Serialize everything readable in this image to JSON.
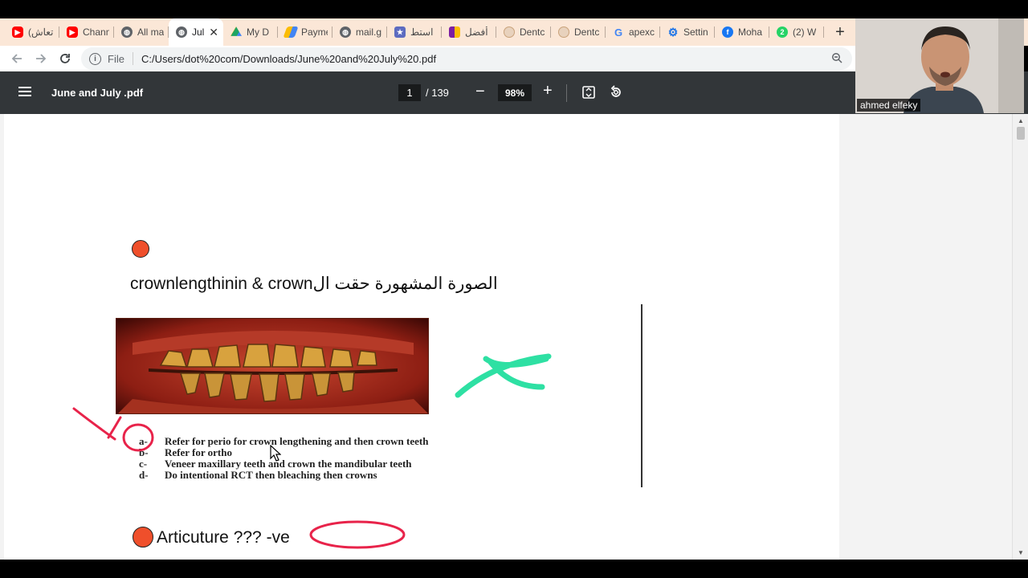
{
  "browser": {
    "tabs": [
      {
        "title": "(تعاش",
        "icon": "youtube-icon",
        "color": "#ff0000"
      },
      {
        "title": "Chann",
        "icon": "youtube-icon",
        "color": "#ff0000"
      },
      {
        "title": "All ma",
        "icon": "globe-icon",
        "color": "#5f6368"
      },
      {
        "title": "Jul",
        "icon": "globe-icon",
        "color": "#5f6368",
        "active": true
      },
      {
        "title": "My D",
        "icon": "google-drive-icon",
        "color": "#1fa463"
      },
      {
        "title": "Payme",
        "icon": "google-ads-icon",
        "color": "#fbbc04"
      },
      {
        "title": "mail.g",
        "icon": "globe-icon",
        "color": "#5f6368"
      },
      {
        "title": "استط",
        "icon": "bookmark-icon",
        "color": "#5c6bc0"
      },
      {
        "title": "أفضل",
        "icon": "slides-icon",
        "color": "#7b1fa2"
      },
      {
        "title": "Dentc",
        "icon": "dental-site-icon",
        "color": "#c9a27a"
      },
      {
        "title": "Dentc",
        "icon": "dental-site-icon",
        "color": "#c9a27a"
      },
      {
        "title": "apexc",
        "icon": "google-icon",
        "color": "#4285f4"
      },
      {
        "title": "Settin",
        "icon": "gear-icon",
        "color": "#1a73e8"
      },
      {
        "title": "Moha",
        "icon": "facebook-icon",
        "color": "#1877f2"
      },
      {
        "title": "(2) W",
        "icon": "whatsapp-icon",
        "color": "#25d366"
      }
    ],
    "new_tab_label": "+",
    "address": {
      "scheme_label": "File",
      "url": "C:/Users/dot%20com/Downloads/June%20and%20July%20.pdf"
    }
  },
  "pdf": {
    "title": "June and July .pdf",
    "current_page": "1",
    "total_pages": "/ 139",
    "zoom": "98%"
  },
  "content": {
    "q1_text": "crownlengthinin & crownالصورة المشهورة حقت ال",
    "options": [
      {
        "letter": "a-",
        "text": "Refer for perio for crown lengthening and then crown teeth"
      },
      {
        "letter": "b-",
        "text": "Refer for ortho"
      },
      {
        "letter": "c-",
        "text": "Veneer maxillary teeth and crown the mandibular teeth"
      },
      {
        "letter": "d-",
        "text": "Do intentional RCT then bleaching then crowns"
      }
    ],
    "q2_text": "Articuture ??? -ve"
  },
  "webcam": {
    "name": "ahmed elfeky"
  },
  "colors": {
    "tabstrip": "#fbe7d7",
    "pdf_toolbar": "#323639",
    "bullet": "#ef4f2b",
    "ink_red": "#e8234a",
    "ink_green": "#2ee0a3"
  }
}
